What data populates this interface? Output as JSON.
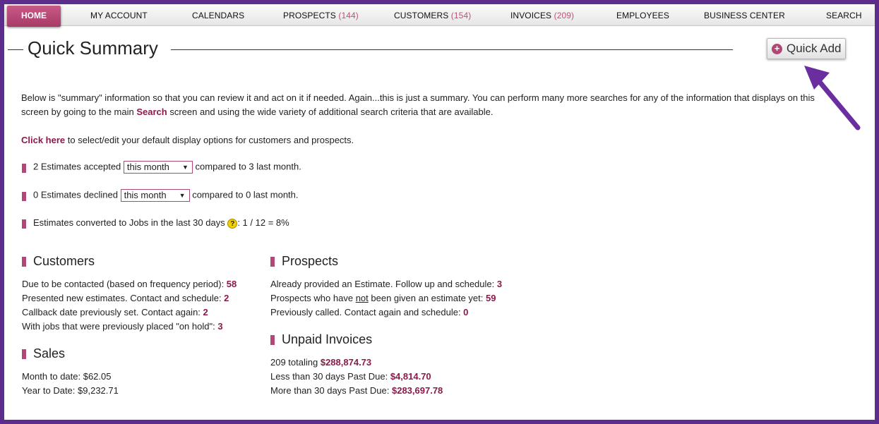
{
  "nav": {
    "home": "HOME",
    "my_account": "MY ACCOUNT",
    "calendars": "CALENDARS",
    "prospects": "PROSPECTS",
    "prospects_count": "(144)",
    "customers": "CUSTOMERS",
    "customers_count": "(154)",
    "invoices": "INVOICES",
    "invoices_count": "(209)",
    "employees": "EMPLOYEES",
    "business_center": "BUSINESS CENTER",
    "search": "SEARCH"
  },
  "page": {
    "title": "Quick Summary",
    "quick_add": "Quick Add"
  },
  "intro": {
    "line1": "Below is \"summary\" information so that you can review it and act on it if needed. Again...this is just a summary. You can perform many more searches for any of the information that displays on this",
    "line2_pre": "screen by going to the main ",
    "line2_link": "Search",
    "line2_post": " screen and using the wide variety of additional search criteria that are available.",
    "click_here": "Click here",
    "click_post": " to select/edit your default display options for customers and prospects."
  },
  "estimates": {
    "accepted_pre": "2 Estimates accepted",
    "accepted_select": "this month",
    "accepted_post": "compared to 3 last month.",
    "declined_pre": "0 Estimates declined",
    "declined_select": "this month",
    "declined_post": "compared to 0 last month.",
    "converted_pre": "Estimates converted to Jobs in the last 30 days",
    "converted_help": "?",
    "converted_post": ": 1 / 12 = 8%"
  },
  "customers": {
    "heading": "Customers",
    "due_label": "Due to be contacted (based on frequency period): ",
    "due_value": "58",
    "presented_label": "Presented new estimates. Contact and schedule: ",
    "presented_value": "2",
    "callback_label": "Callback date previously set. Contact again: ",
    "callback_value": "2",
    "onhold_label": "With jobs that were previously placed \"on hold\": ",
    "onhold_value": "3"
  },
  "sales": {
    "heading": "Sales",
    "month_label": "Month to date: $62.05",
    "year_label": "Year to Date: $9,232.71"
  },
  "prospects": {
    "heading": "Prospects",
    "provided_label": "Already provided an Estimate. Follow up and schedule: ",
    "provided_value": "3",
    "not_given_pre": "Prospects who have ",
    "not_given_u": "not",
    "not_given_post": " been given an estimate yet: ",
    "not_given_value": "59",
    "called_label": "Previously called. Contact again and schedule: ",
    "called_value": "0"
  },
  "unpaid": {
    "heading": "Unpaid Invoices",
    "total_label": "209 totaling ",
    "total_value": "$288,874.73",
    "lt30_label": "Less than 30 days Past Due: ",
    "lt30_value": "$4,814.70",
    "gt30_label": "More than 30 days Past Due: ",
    "gt30_value": "$283,697.78"
  },
  "colors": {
    "frame": "#5c2d8c",
    "accent": "#b04777",
    "value": "#8b1a4b"
  }
}
